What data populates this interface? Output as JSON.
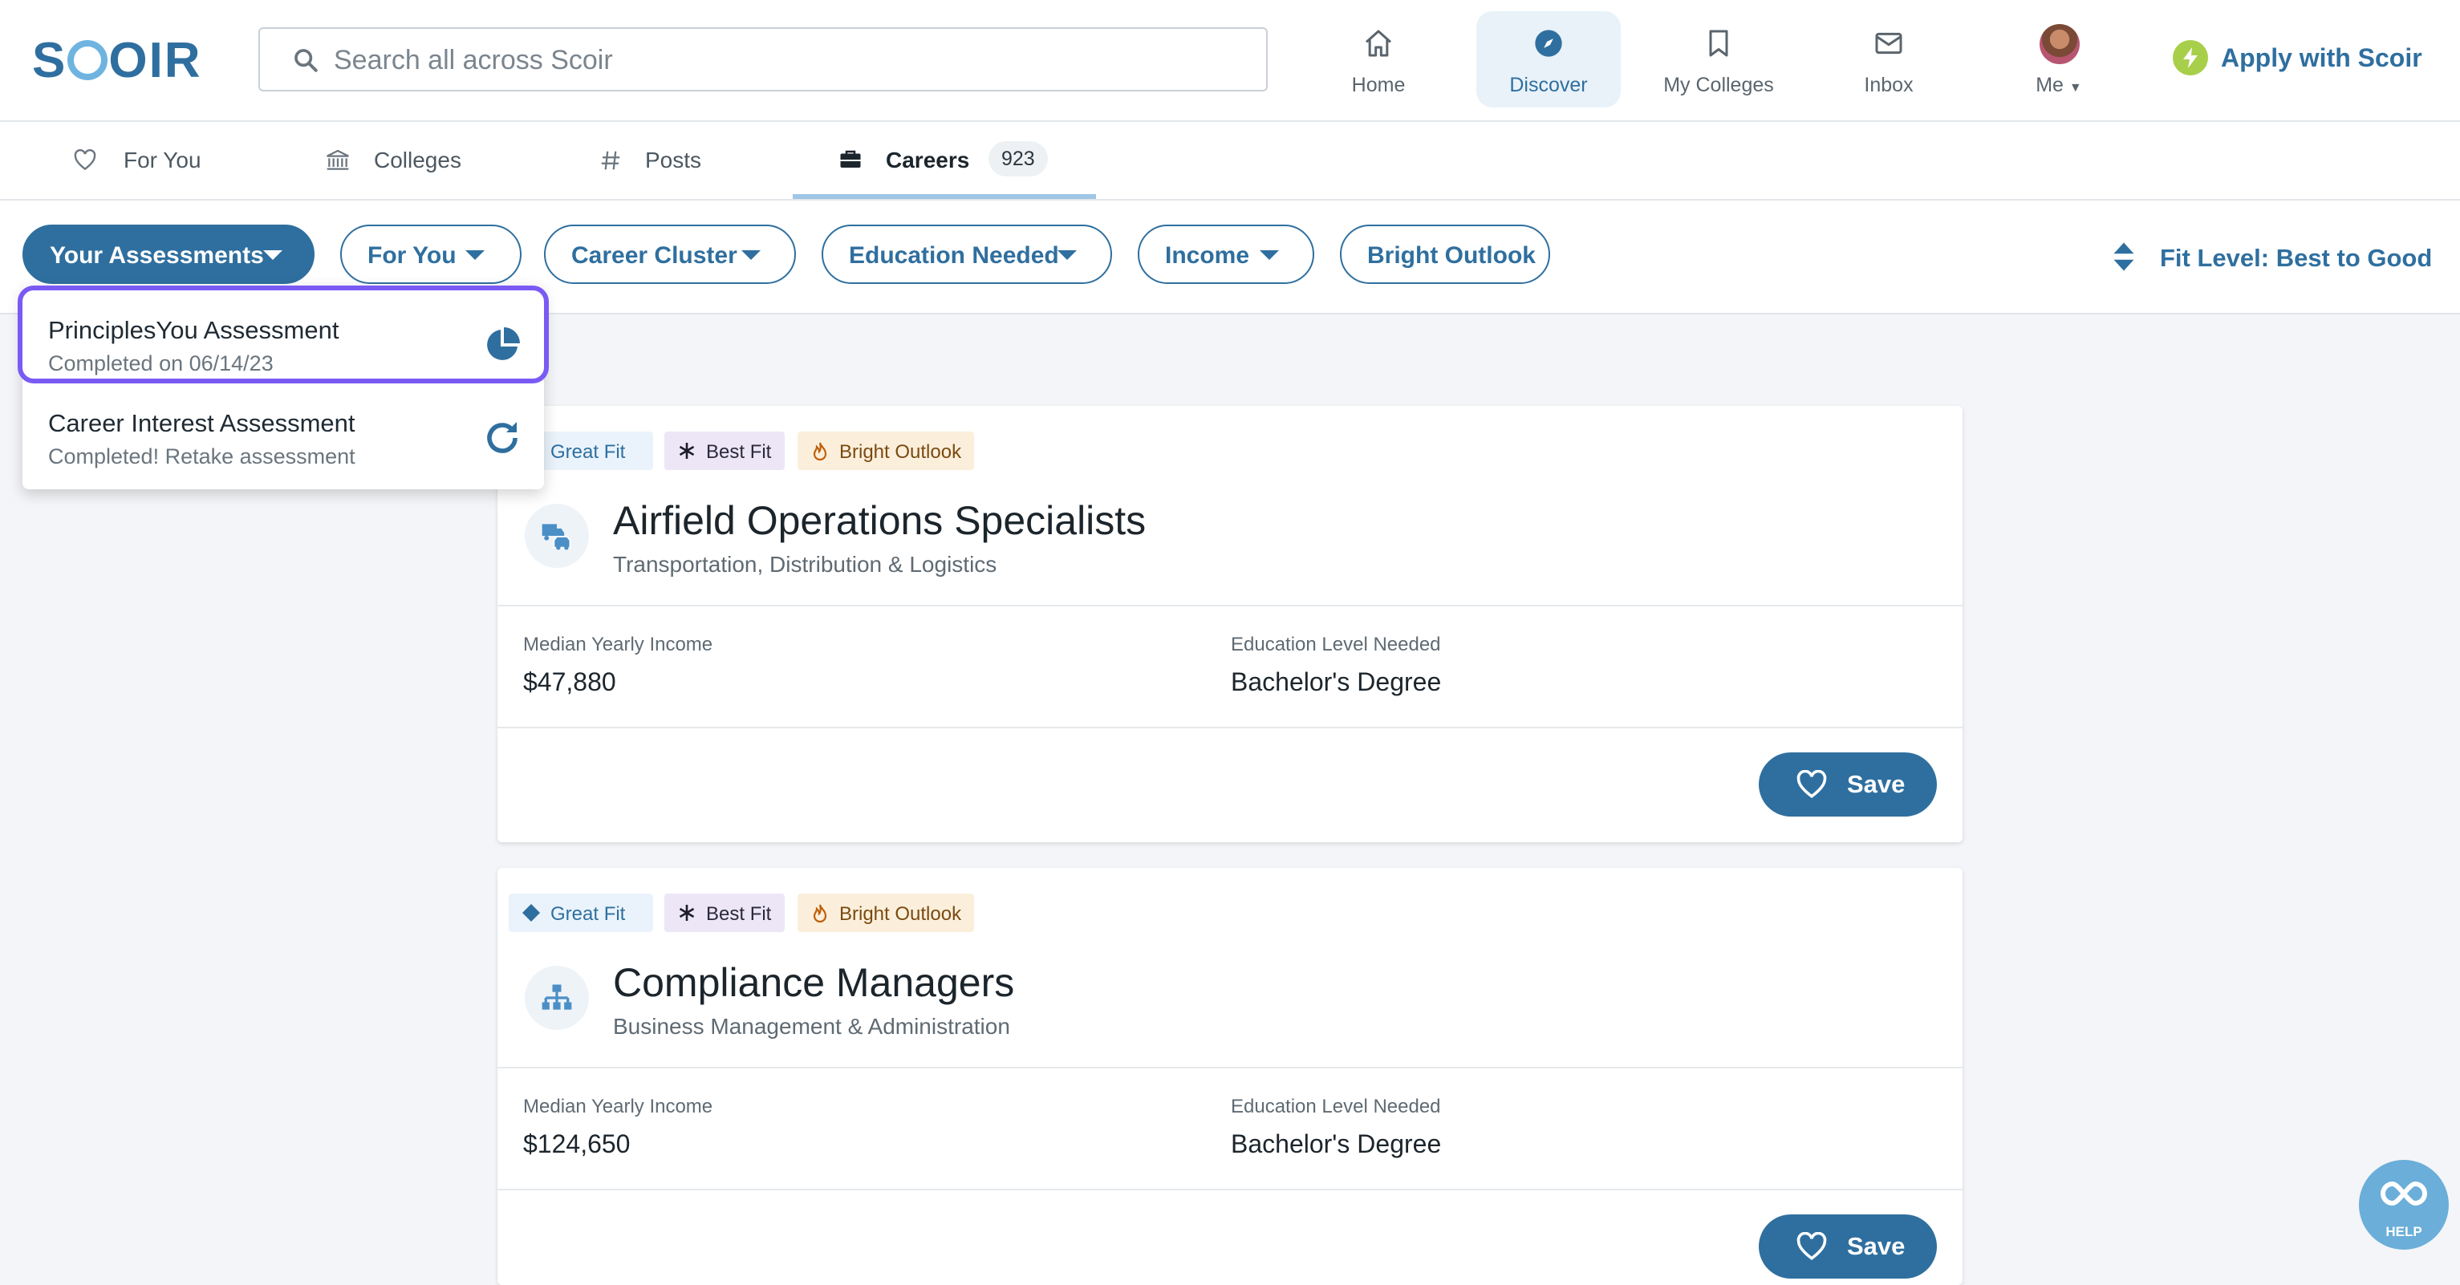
{
  "app": {
    "logo": "SCOIR"
  },
  "search": {
    "placeholder": "Search all across Scoir"
  },
  "nav": [
    {
      "label": "Home",
      "icon": "home-icon"
    },
    {
      "label": "Discover",
      "icon": "compass-icon",
      "active": true
    },
    {
      "label": "My Colleges",
      "icon": "bookmark-icon"
    },
    {
      "label": "Inbox",
      "icon": "inbox-icon"
    },
    {
      "label": "Me",
      "icon": "avatar"
    }
  ],
  "apply": {
    "label": "Apply with Scoir"
  },
  "tabs": [
    {
      "label": "For You",
      "icon": "heart-icon"
    },
    {
      "label": "Colleges",
      "icon": "institution-icon"
    },
    {
      "label": "Posts",
      "icon": "hashtag-icon"
    },
    {
      "label": "Careers",
      "icon": "briefcase-icon",
      "count": "923",
      "active": true
    }
  ],
  "filters": {
    "your_assessments": "Your Assessments",
    "for_you": "For You",
    "career_cluster": "Career Cluster",
    "education_needed": "Education Needed",
    "income": "Income",
    "bright_outlook": "Bright Outlook",
    "sort": "Fit Level: Best to Good"
  },
  "assessments_menu": [
    {
      "title": "PrinciplesYou Assessment",
      "subtitle": "Completed on 06/14/23",
      "icon": "pie-chart-icon"
    },
    {
      "title": "Career Interest Assessment",
      "subtitle": "Completed! Retake assessment",
      "icon": "refresh-icon"
    }
  ],
  "careers": [
    {
      "badges": {
        "great": "Great Fit",
        "best": "Best Fit",
        "bright": "Bright Outlook"
      },
      "title": "Airfield Operations Specialists",
      "cluster": "Transportation, Distribution & Logistics",
      "income_label": "Median Yearly Income",
      "income": "$47,880",
      "education_label": "Education Level Needed",
      "education": "Bachelor's Degree",
      "save": "Save",
      "icon": "truck-car-icon"
    },
    {
      "badges": {
        "great": "Great Fit",
        "best": "Best Fit",
        "bright": "Bright Outlook"
      },
      "title": "Compliance Managers",
      "cluster": "Business Management & Administration",
      "income_label": "Median Yearly Income",
      "income": "$124,650",
      "education_label": "Education Level Needed",
      "education": "Bachelor's Degree",
      "save": "Save",
      "icon": "org-chart-icon"
    }
  ],
  "help": {
    "label": "HELP"
  },
  "colors": {
    "primary": "#2f6f9f",
    "highlight": "#7a5af5",
    "apply_bolt": "#a7cf4a"
  }
}
